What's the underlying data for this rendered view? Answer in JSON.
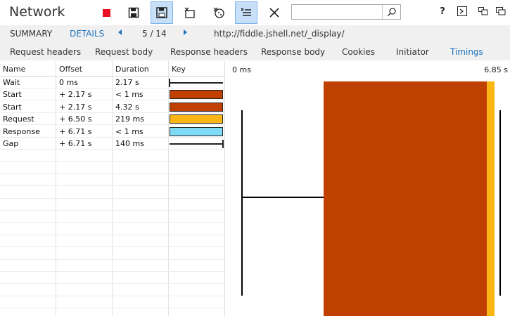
{
  "app": {
    "title": "Network"
  },
  "toolbar": {
    "buttons": [
      {
        "name": "stop-record-button",
        "icon": "stop-icon",
        "color": "#e81123",
        "active": false
      },
      {
        "name": "export-har-button",
        "icon": "save-icon",
        "active": true
      },
      {
        "name": "clear-entries-button",
        "icon": "clear-entries-icon",
        "active": false
      },
      {
        "name": "clear-cache-button",
        "icon": "clear-cache-icon",
        "active": false
      },
      {
        "name": "clear-cookies-button",
        "icon": "cookie-icon",
        "active": false
      },
      {
        "name": "always-clear-button",
        "icon": "list-check-icon",
        "active": true
      },
      {
        "name": "close-button",
        "icon": "close-icon",
        "active": false
      }
    ],
    "search": {
      "value": "",
      "placeholder": ""
    },
    "right_buttons": [
      {
        "name": "help-button",
        "label": "?",
        "icon": "help-icon"
      },
      {
        "name": "console-button",
        "label": ">",
        "icon": "console-icon"
      },
      {
        "name": "dock-button",
        "label": "",
        "icon": "dock-icon"
      },
      {
        "name": "window-button",
        "label": "",
        "icon": "window-icon"
      }
    ]
  },
  "nav": {
    "summary_label": "SUMMARY",
    "details_label": "DETAILS",
    "position": "5 / 14",
    "url": "http://fiddle.jshell.net/_display/"
  },
  "tabs": [
    {
      "label": "Request headers",
      "active": false
    },
    {
      "label": "Request body",
      "active": false
    },
    {
      "label": "Response headers",
      "active": false
    },
    {
      "label": "Response body",
      "active": false
    },
    {
      "label": "Cookies",
      "active": false
    },
    {
      "label": "Initiator",
      "active": false
    },
    {
      "label": "Timings",
      "active": true
    }
  ],
  "grid": {
    "headers": [
      "Name",
      "Offset",
      "Duration",
      "Key"
    ],
    "rows": [
      {
        "name": "Wait",
        "offset": "0 ms",
        "duration": "2.17 s",
        "key": "line-left-tick"
      },
      {
        "name": "Start",
        "offset": "+ 2.17 s",
        "duration": "< 1 ms",
        "key": "box",
        "color": "#c04000"
      },
      {
        "name": "Start",
        "offset": "+ 2.17 s",
        "duration": "4.32 s",
        "key": "box",
        "color": "#c04000"
      },
      {
        "name": "Request",
        "offset": "+ 6.50 s",
        "duration": "219 ms",
        "key": "box",
        "color": "#fbb614"
      },
      {
        "name": "Response",
        "offset": "+ 6.71 s",
        "duration": "< 1 ms",
        "key": "box",
        "color": "#7fdbf5"
      },
      {
        "name": "Gap",
        "offset": "+ 6.71 s",
        "duration": "140 ms",
        "key": "line-right-tick"
      }
    ]
  },
  "timeline": {
    "start_label": "0 ms",
    "end_label": "6.85 s",
    "total_s": 6.85,
    "colors": {
      "start": "#c04000",
      "request": "#fbb614",
      "response": "#7fdbf5",
      "line": "#000000"
    }
  }
}
